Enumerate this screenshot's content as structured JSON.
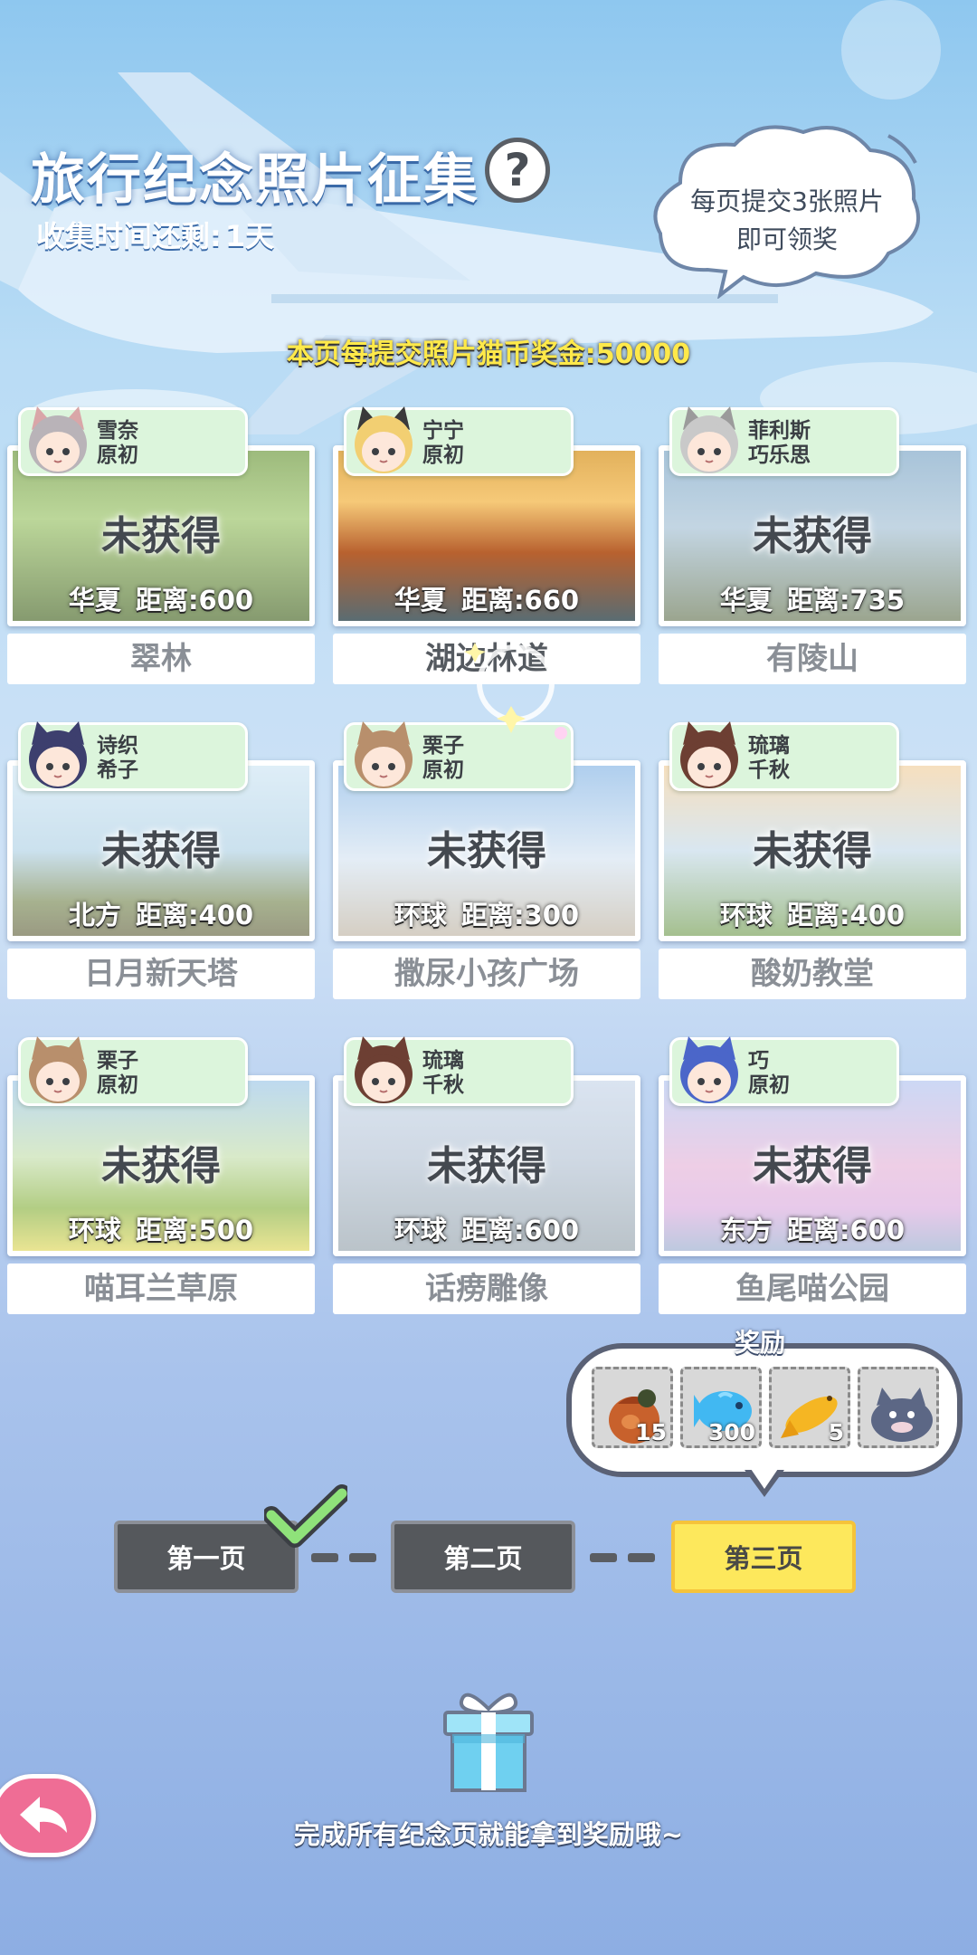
{
  "header": {
    "title": "旅行纪念照片征集",
    "help_label": "?",
    "countdown_label": "收集时间还剩:",
    "countdown_value": "1天"
  },
  "bubble": {
    "line1": "每页提交3张照片",
    "line2": "即可领奖"
  },
  "bonus": {
    "text": "本页每提交照片猫币奖金:50000"
  },
  "photos": [
    {
      "char1": "雪奈",
      "char2": "原初",
      "status": "未获得",
      "region": "华夏",
      "distance": "距离:600",
      "place": "翠林",
      "avatar_color": "#b9b3b8",
      "ear": "#d9a6a8"
    },
    {
      "char1": "宁宁",
      "char2": "原初",
      "status": "",
      "region": "华夏",
      "distance": "距离:660",
      "place": "湖边林道",
      "avatar_color": "#f2cf72",
      "ear": "#3a3a3a"
    },
    {
      "char1": "菲利斯",
      "char2": "巧乐思",
      "status": "未获得",
      "region": "华夏",
      "distance": "距离:735",
      "place": "有陵山",
      "avatar_color": "#c9c9c9",
      "ear": "#9b9b9b"
    },
    {
      "char1": "诗织",
      "char2": "希子",
      "status": "未获得",
      "region": "北方",
      "distance": "距离:400",
      "place": "日月新天塔",
      "avatar_color": "#3d3f6e",
      "ear": "#3d3f6e"
    },
    {
      "char1": "栗子",
      "char2": "原初",
      "status": "未获得",
      "region": "环球",
      "distance": "距离:300",
      "place": "撒尿小孩广场",
      "avatar_color": "#b88f6c",
      "ear": "#b88f6c"
    },
    {
      "char1": "琉璃",
      "char2": "千秋",
      "status": "未获得",
      "region": "环球",
      "distance": "距离:400",
      "place": "酸奶教堂",
      "avatar_color": "#6d3f33",
      "ear": "#6d3f33"
    },
    {
      "char1": "栗子",
      "char2": "原初",
      "status": "未获得",
      "region": "环球",
      "distance": "距离:500",
      "place": "喵耳兰草原",
      "avatar_color": "#b88f6c",
      "ear": "#b88f6c"
    },
    {
      "char1": "琉璃",
      "char2": "千秋",
      "status": "未获得",
      "region": "环球",
      "distance": "距离:600",
      "place": "话痨雕像",
      "avatar_color": "#6d3f33",
      "ear": "#6d3f33"
    },
    {
      "char1": "巧",
      "char2": "原初",
      "status": "未获得",
      "region": "东方",
      "distance": "距离:600",
      "place": "鱼尾喵公园",
      "avatar_color": "#4b66c9",
      "ear": "#4b66c9"
    }
  ],
  "rewards": {
    "label": "奖励",
    "items": [
      {
        "icon": "bag-icon",
        "qty": "15"
      },
      {
        "icon": "blue-fish-icon",
        "qty": "300"
      },
      {
        "icon": "gold-fish-icon",
        "qty": "5"
      },
      {
        "icon": "cat-figure-icon",
        "qty": ""
      }
    ]
  },
  "pages": {
    "page1": "第一页",
    "page2": "第二页",
    "page3": "第三页"
  },
  "footer": {
    "hint": "完成所有纪念页就能拿到奖励哦~"
  },
  "colors": {
    "tag_bg": "#dcf5dc",
    "current_page": "#fde85c",
    "back_button": "#ef6d95"
  }
}
